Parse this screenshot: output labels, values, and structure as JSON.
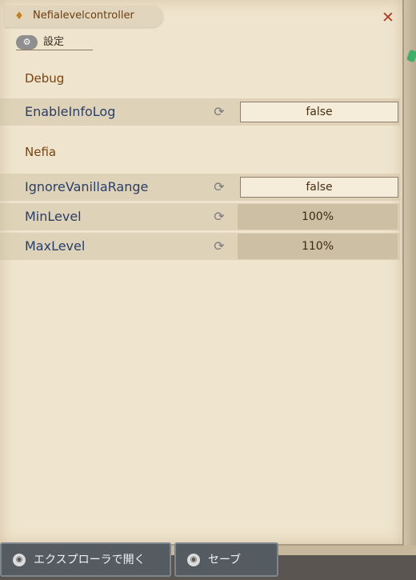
{
  "window": {
    "title": "Nefialevelcontroller",
    "title_icon": "lantern-icon",
    "close_symbol": "✕"
  },
  "tabs": [
    {
      "label": "設定",
      "icon": "gear-icon"
    }
  ],
  "sections": [
    {
      "title": "Debug",
      "rows": [
        {
          "label": "EnableInfoLog",
          "type": "toggle",
          "value": "false"
        }
      ]
    },
    {
      "title": "Nefia",
      "rows": [
        {
          "label": "IgnoreVanillaRange",
          "type": "toggle",
          "value": "false"
        },
        {
          "label": "MinLevel",
          "type": "slider",
          "value": "100%"
        },
        {
          "label": "MaxLevel",
          "type": "slider",
          "value": "110%"
        }
      ]
    }
  ],
  "reset_symbol": "⟳",
  "footer": {
    "open_explorer_label": "エクスプローラで開く",
    "save_label": "セーブ"
  },
  "colors": {
    "panel_bg": "#efe4cd",
    "section_title": "#7a4310",
    "row_label": "#2a3e6a",
    "close": "#b23b2a",
    "button_bg": "#545c62"
  }
}
